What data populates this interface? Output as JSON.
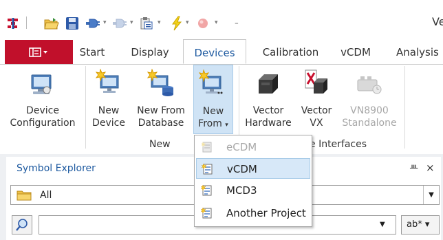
{
  "qat": {
    "icons": [
      "app-logo-icon",
      "open-folder-icon",
      "save-icon",
      "connect-icon",
      "disconnect-icon",
      "clipboard-icon",
      "lightning-icon",
      "record-icon",
      "customize-icon"
    ],
    "title_fragment": "Ve"
  },
  "tabs": {
    "file_label": "",
    "items": [
      {
        "label": "Start"
      },
      {
        "label": "Display"
      },
      {
        "label": "Devices"
      },
      {
        "label": "Calibration"
      },
      {
        "label": "vCDM"
      },
      {
        "label": "Analysis"
      }
    ],
    "active": "Devices"
  },
  "ribbon": {
    "device_configuration": {
      "line1": "Device",
      "line2": "Configuration"
    },
    "new_device": {
      "line1": "New",
      "line2": "Device"
    },
    "new_from_database": {
      "line1": "New From",
      "line2": "Database"
    },
    "new_from": {
      "line1": "New",
      "line2": "From"
    },
    "vector_hardware": {
      "line1": "Vector",
      "line2": "Hardware"
    },
    "vector_vx": {
      "line1": "Vector",
      "line2": "VX"
    },
    "vn8900": {
      "line1": "VN8900",
      "line2": "Standalone"
    },
    "group_new": "New",
    "group_interfaces_fragment": "e Interfaces"
  },
  "menu": {
    "items": [
      {
        "label": "eCDM",
        "disabled": true,
        "icon": "ecdm-icon"
      },
      {
        "label": "vCDM",
        "disabled": false,
        "icon": "vcdm-icon"
      },
      {
        "label": "MCD3",
        "disabled": false,
        "icon": "mcd3-icon"
      },
      {
        "label": "Another Project",
        "disabled": false,
        "icon": "project-icon"
      }
    ],
    "highlighted": "vCDM"
  },
  "symbol_explorer": {
    "title": "Symbol Explorer",
    "pin_glyph": "ᚈ",
    "close_glyph": "×",
    "filter_value": "All",
    "search_value": "",
    "search_arrow": "▼",
    "ab_filter": "ab* ▾"
  },
  "colors": {
    "accent_blue": "#1e5aa0",
    "file_tab_red": "#c1102b",
    "hover_blue": "#cfe3f5"
  }
}
